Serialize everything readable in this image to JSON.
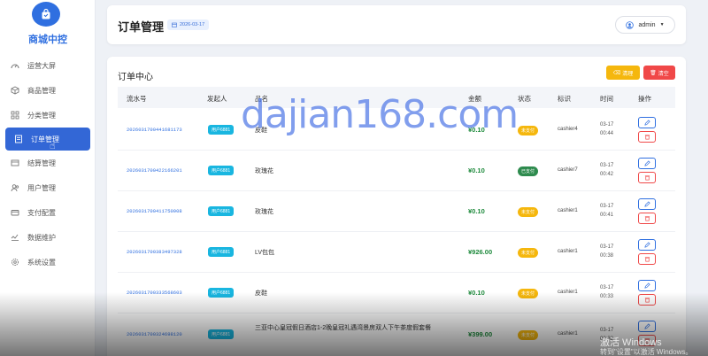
{
  "brand": {
    "name": "商城中控"
  },
  "sidebar": {
    "items": [
      {
        "label": "运营大屏",
        "icon": "dashboard-icon"
      },
      {
        "label": "商品管理",
        "icon": "box-icon"
      },
      {
        "label": "分类管理",
        "icon": "grid-icon"
      },
      {
        "label": "订单管理",
        "icon": "document-icon",
        "active": true
      },
      {
        "label": "结算管理",
        "icon": "settlement-icon"
      },
      {
        "label": "用户管理",
        "icon": "users-icon"
      },
      {
        "label": "支付配置",
        "icon": "card-icon"
      },
      {
        "label": "数据维护",
        "icon": "database-icon"
      },
      {
        "label": "系统设置",
        "icon": "gear-icon"
      }
    ]
  },
  "header": {
    "title": "订单管理",
    "date": "2026-03-17",
    "user": "admin"
  },
  "orders": {
    "title": "订单中心",
    "clean_label": "清理",
    "clear_label": "清空",
    "columns": {
      "serial": "流水号",
      "initiator": "发起人",
      "name": "品名",
      "amount": "金额",
      "status": "状态",
      "tag": "标识",
      "time": "时间",
      "actions": "操作"
    },
    "rows": [
      {
        "serial": "2026031700441681173",
        "initiator": "用户6881",
        "name": "皮鞋",
        "amount": "¥0.10",
        "status": "未支付",
        "paid": false,
        "tag": "cashier4",
        "date": "03-17",
        "clock": "00:44"
      },
      {
        "serial": "2026031700422166201",
        "initiator": "用户6881",
        "name": "玫瑰花",
        "amount": "¥0.10",
        "status": "已支付",
        "paid": true,
        "tag": "cashier7",
        "date": "03-17",
        "clock": "00:42"
      },
      {
        "serial": "2026031700411750908",
        "initiator": "用户6881",
        "name": "玫瑰花",
        "amount": "¥0.10",
        "status": "未支付",
        "paid": false,
        "tag": "cashier1",
        "date": "03-17",
        "clock": "00:41"
      },
      {
        "serial": "2026031700383497328",
        "initiator": "用户6881",
        "name": "LV包包",
        "amount": "¥926.00",
        "status": "未支付",
        "paid": false,
        "tag": "cashier1",
        "date": "03-17",
        "clock": "00:38"
      },
      {
        "serial": "2026031700333568603",
        "initiator": "用户6881",
        "name": "皮鞋",
        "amount": "¥0.10",
        "status": "未支付",
        "paid": false,
        "tag": "cashier1",
        "date": "03-17",
        "clock": "00:33"
      },
      {
        "serial": "2026031700324698120",
        "initiator": "用户6881",
        "name": "三亚中心皇冠假日酒店1-2晚皇冠礼遇湾景房双人下午茶度假套餐",
        "amount": "¥399.00",
        "status": "未支付",
        "paid": false,
        "tag": "cashier1",
        "date": "03-17",
        "clock": "00:32"
      }
    ]
  },
  "overlay": {
    "watermark": "dajian168.com",
    "windows_activate": "激活 Windows",
    "windows_activate_sub": "转到\"设置\"以激活 Windows。"
  },
  "colors": {
    "primary": "#2f6fe0",
    "active_nav": "#3367d6",
    "warning": "#f5b70d",
    "danger": "#f04848",
    "success": "#2e8b4e",
    "info": "#19b6e0",
    "amount": "#1e8a3c"
  }
}
